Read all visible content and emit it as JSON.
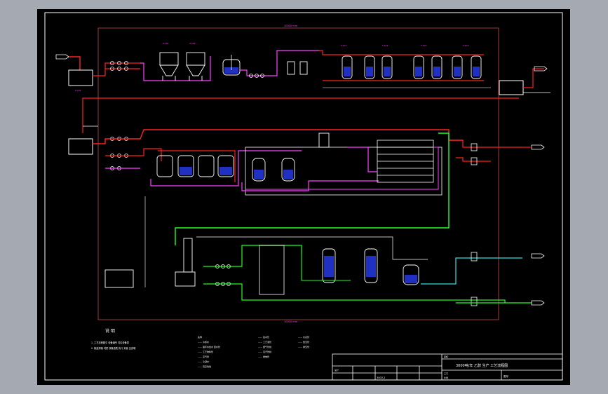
{
  "drawing": {
    "colors": {
      "background": "#a5a9b2",
      "sheet": "#000000",
      "border": "#ffffff",
      "area_outline": "#c84848",
      "water_line": "#ff2020",
      "chemical_line": "#ff40ff",
      "steam_line": "#20ff20",
      "return_line": "#30e0e0",
      "equipment": "#ffffff",
      "label": "#ff40ff",
      "note": "#ffffff"
    },
    "labels": {
      "area_top": "10000 mm",
      "area_bottom": "10000 mm",
      "notes_title": "说    明",
      "note_1": "1. 工艺流程图中 设备编号 详见设备表",
      "note_2": "2. 管道规格 材质 按管道表 执行 安装 见说明",
      "legend_a": [
        "名称",
        "—— 冷却水",
        "—— 循环水给水 回水管",
        "—— 工艺物料管",
        "—— 蒸汽管",
        "—— 冷凝水",
        "—— 真空管线"
      ],
      "legend_b": [
        "—— 给水管",
        "—— 工艺液管",
        "—— 废气管线",
        "—— 蒸汽管线",
        "—— 排放管"
      ],
      "legend_c": [
        "—— 仪表管",
        "—— 放空管",
        "—— 排空管"
      ]
    },
    "title_block": {
      "project": "3000吨/年 乙醇 生产 工艺流程图",
      "drawing_no": "3003-2",
      "row_labels": [
        "设计",
        "审核",
        "工艺",
        "比例",
        "图号"
      ]
    }
  }
}
